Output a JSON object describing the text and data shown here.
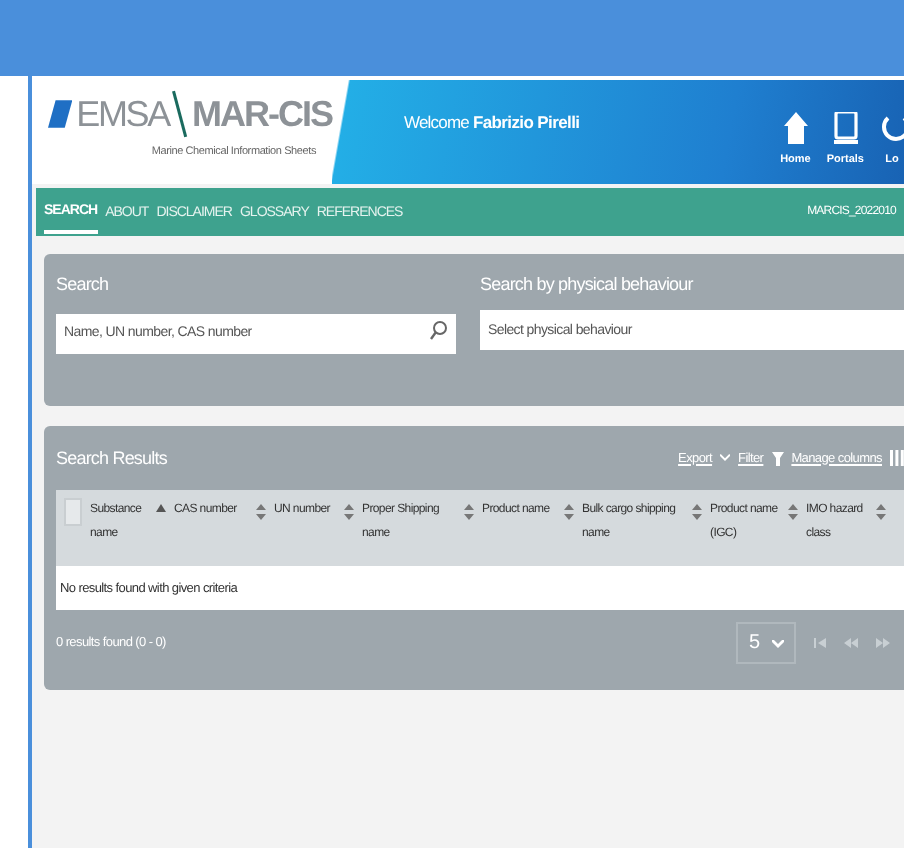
{
  "header": {
    "logo": {
      "left": "EMSA",
      "right": "MAR-CIS",
      "subtitle": "Marine Chemical Information Sheets"
    },
    "welcome": {
      "prefix": "Welcome",
      "user": "Fabrizio Pirelli"
    },
    "nav_icons": [
      {
        "kind": "home",
        "label": "Home"
      },
      {
        "kind": "portals",
        "label": "Portals"
      },
      {
        "kind": "logout",
        "label": "Lo"
      }
    ]
  },
  "nav": {
    "items": [
      {
        "label": "SEARCH",
        "selected": true
      },
      {
        "label": "ABOUT",
        "selected": false
      },
      {
        "label": "DISCLAIMER",
        "selected": false
      },
      {
        "label": "GLOSSARY",
        "selected": false
      },
      {
        "label": "REFERENCES",
        "selected": false
      }
    ],
    "version": "MARCIS_2022010"
  },
  "search": {
    "title": "Search",
    "placeholder": "Name, UN number, CAS number",
    "behaviour_title": "Search by physical behaviour",
    "behaviour_placeholder": "Select physical behaviour"
  },
  "results": {
    "title": "Search Results",
    "actions": [
      {
        "kind": "export",
        "label": "Export"
      },
      {
        "kind": "filter",
        "label": "Filter"
      },
      {
        "kind": "columns",
        "label": "Manage columns"
      }
    ],
    "select_all_checked": false,
    "columns": [
      {
        "label": "Substance name",
        "sorted": true
      },
      {
        "label": "CAS number",
        "sorted": false
      },
      {
        "label": "UN number",
        "sorted": false
      },
      {
        "label": "Proper Shipping name",
        "sorted": false
      },
      {
        "label": "Product name",
        "sorted": false
      },
      {
        "label": "Bulk cargo shipping name",
        "sorted": false
      },
      {
        "label": "Product name (IGC)",
        "sorted": false
      },
      {
        "label": "IMO hazard class",
        "sorted": false
      }
    ],
    "empty_message": "No results found with given criteria",
    "summary": "0 results found (0 - 0)",
    "page_size": "5"
  }
}
